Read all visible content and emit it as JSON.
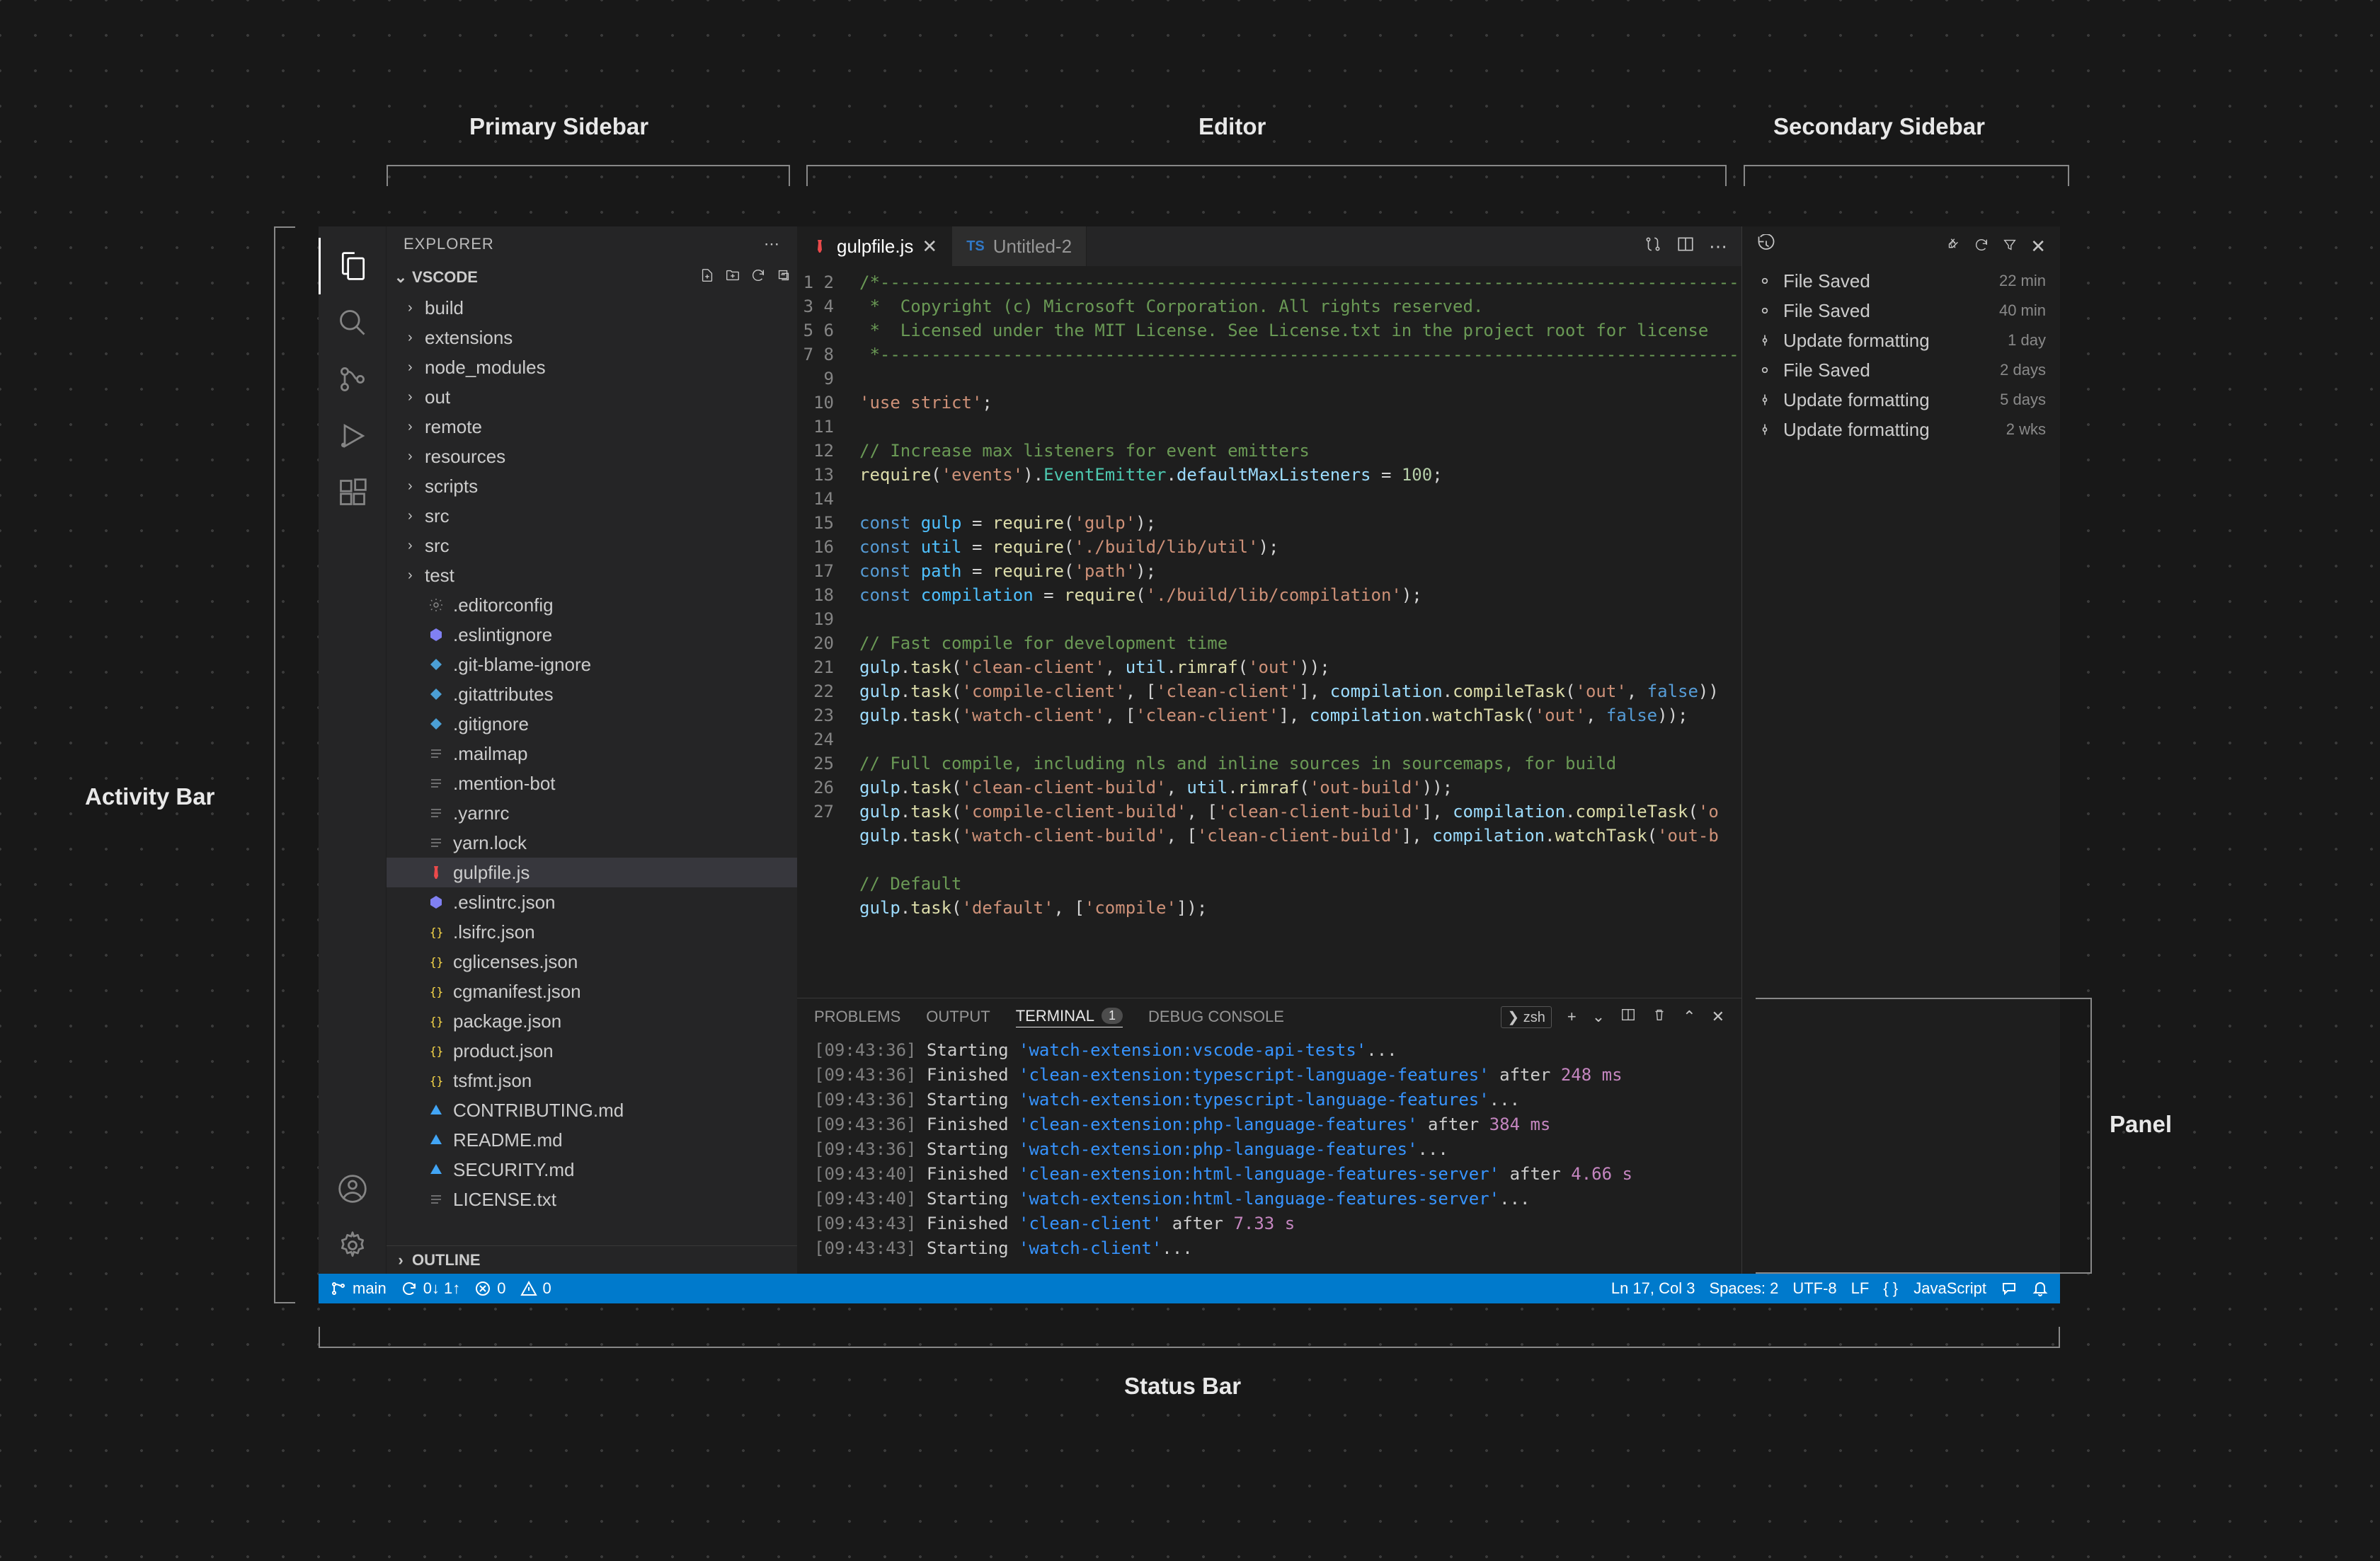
{
  "annotations": {
    "activity_bar": "Activity Bar",
    "primary_sidebar": "Primary Sidebar",
    "editor": "Editor",
    "secondary_sidebar": "Secondary Sidebar",
    "panel": "Panel",
    "status_bar": "Status Bar"
  },
  "sidebar": {
    "title": "EXPLORER",
    "project_name": "VSCODE",
    "outline_title": "OUTLINE",
    "tree": [
      {
        "type": "folder",
        "name": "build"
      },
      {
        "type": "folder",
        "name": "extensions"
      },
      {
        "type": "folder",
        "name": "node_modules"
      },
      {
        "type": "folder",
        "name": "out"
      },
      {
        "type": "folder",
        "name": "remote"
      },
      {
        "type": "folder",
        "name": "resources"
      },
      {
        "type": "folder",
        "name": "scripts"
      },
      {
        "type": "folder",
        "name": "src"
      },
      {
        "type": "folder",
        "name": "src"
      },
      {
        "type": "folder",
        "name": "test"
      },
      {
        "type": "file",
        "name": ".editorconfig",
        "icon": "gear"
      },
      {
        "type": "file",
        "name": ".eslintignore",
        "icon": "eslint"
      },
      {
        "type": "file",
        "name": ".git-blame-ignore",
        "icon": "diamond"
      },
      {
        "type": "file",
        "name": ".gitattributes",
        "icon": "diamond"
      },
      {
        "type": "file",
        "name": ".gitignore",
        "icon": "diamond"
      },
      {
        "type": "file",
        "name": ".mailmap",
        "icon": "lines"
      },
      {
        "type": "file",
        "name": ".mention-bot",
        "icon": "lines"
      },
      {
        "type": "file",
        "name": ".yarnrc",
        "icon": "lines"
      },
      {
        "type": "file",
        "name": "yarn.lock",
        "icon": "lines"
      },
      {
        "type": "file",
        "name": "gulpfile.js",
        "icon": "gulp",
        "selected": true
      },
      {
        "type": "file",
        "name": ".eslintrc.json",
        "icon": "eslint"
      },
      {
        "type": "file",
        "name": ".lsifrc.json",
        "icon": "json"
      },
      {
        "type": "file",
        "name": "cglicenses.json",
        "icon": "json"
      },
      {
        "type": "file",
        "name": "cgmanifest.json",
        "icon": "json"
      },
      {
        "type": "file",
        "name": "package.json",
        "icon": "json"
      },
      {
        "type": "file",
        "name": "product.json",
        "icon": "json"
      },
      {
        "type": "file",
        "name": "tsfmt.json",
        "icon": "json"
      },
      {
        "type": "file",
        "name": "CONTRIBUTING.md",
        "icon": "md"
      },
      {
        "type": "file",
        "name": "README.md",
        "icon": "md"
      },
      {
        "type": "file",
        "name": "SECURITY.md",
        "icon": "md"
      },
      {
        "type": "file",
        "name": "LICENSE.txt",
        "icon": "lines"
      }
    ]
  },
  "tabs": [
    {
      "label": "gulpfile.js",
      "icon": "gulp",
      "active": true,
      "closeable": true
    },
    {
      "label": "Untitled-2",
      "icon": "ts",
      "prefix": "TS"
    }
  ],
  "editor": {
    "lines": 27
  },
  "panel": {
    "tabs": {
      "problems": "PROBLEMS",
      "output": "OUTPUT",
      "terminal": "TERMINAL",
      "terminal_badge": "1",
      "debug": "DEBUG CONSOLE"
    },
    "shell": "zsh",
    "terminal_lines": [
      {
        "time": "[09:43:36]",
        "action": "Starting",
        "task": "'watch-extension:vscode-api-tests'",
        "tail": "..."
      },
      {
        "time": "[09:43:36]",
        "action": "Finished",
        "task": "'clean-extension:typescript-language-features'",
        "tail": " after ",
        "dur": "248 ms"
      },
      {
        "time": "[09:43:36]",
        "action": "Starting",
        "task": "'watch-extension:typescript-language-features'",
        "tail": "..."
      },
      {
        "time": "[09:43:36]",
        "action": "Finished",
        "task": "'clean-extension:php-language-features'",
        "tail": " after ",
        "dur": "384 ms"
      },
      {
        "time": "[09:43:36]",
        "action": "Starting",
        "task": "'watch-extension:php-language-features'",
        "tail": "..."
      },
      {
        "time": "[09:43:40]",
        "action": "Finished",
        "task": "'clean-extension:html-language-features-server'",
        "tail": " after ",
        "dur": "4.66 s"
      },
      {
        "time": "[09:43:40]",
        "action": "Starting",
        "task": "'watch-extension:html-language-features-server'",
        "tail": "..."
      },
      {
        "time": "[09:43:43]",
        "action": "Finished",
        "task": "'clean-client'",
        "tail": " after ",
        "dur": "7.33 s"
      },
      {
        "time": "[09:43:43]",
        "action": "Starting",
        "task": "'watch-client'",
        "tail": "..."
      }
    ]
  },
  "timeline": [
    {
      "icon": "circle",
      "label": "File Saved",
      "when": "22 min"
    },
    {
      "icon": "circle",
      "label": "File Saved",
      "when": "40 min"
    },
    {
      "icon": "commit",
      "label": "Update formatting",
      "when": "1 day"
    },
    {
      "icon": "circle",
      "label": "File Saved",
      "when": "2 days"
    },
    {
      "icon": "commit",
      "label": "Update formatting",
      "when": "5 days"
    },
    {
      "icon": "commit",
      "label": "Update formatting",
      "when": "2 wks"
    }
  ],
  "status": {
    "branch": "main",
    "sync": "0↓ 1↑",
    "errors": "0",
    "warnings": "0",
    "position": "Ln 17, Col 3",
    "spaces": "Spaces: 2",
    "encoding": "UTF-8",
    "eol": "LF",
    "lang_prefix": "{ }",
    "language": "JavaScript"
  }
}
